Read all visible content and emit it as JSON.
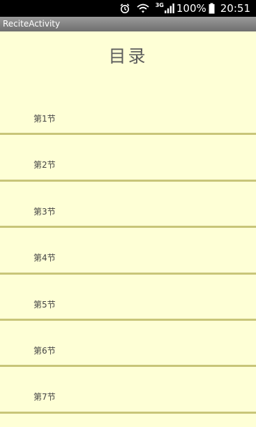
{
  "status_bar": {
    "alarm_icon": "alarm-clock-icon",
    "wifi_icon": "wifi-icon",
    "network_type": "3G",
    "signal_icon": "signal-bars-icon",
    "battery_percent": "100%",
    "battery_icon": "battery-icon",
    "time": "20:51"
  },
  "app_bar": {
    "title": "ReciteActivity"
  },
  "main": {
    "title": "目录",
    "sections": [
      {
        "label": "第1节"
      },
      {
        "label": "第2节"
      },
      {
        "label": "第3节"
      },
      {
        "label": "第4节"
      },
      {
        "label": "第5节"
      },
      {
        "label": "第6节"
      },
      {
        "label": "第7节"
      }
    ]
  },
  "colors": {
    "background": "#feffd6",
    "divider": "#c8c579",
    "status_bar": "#000000",
    "app_bar": "#858585"
  }
}
